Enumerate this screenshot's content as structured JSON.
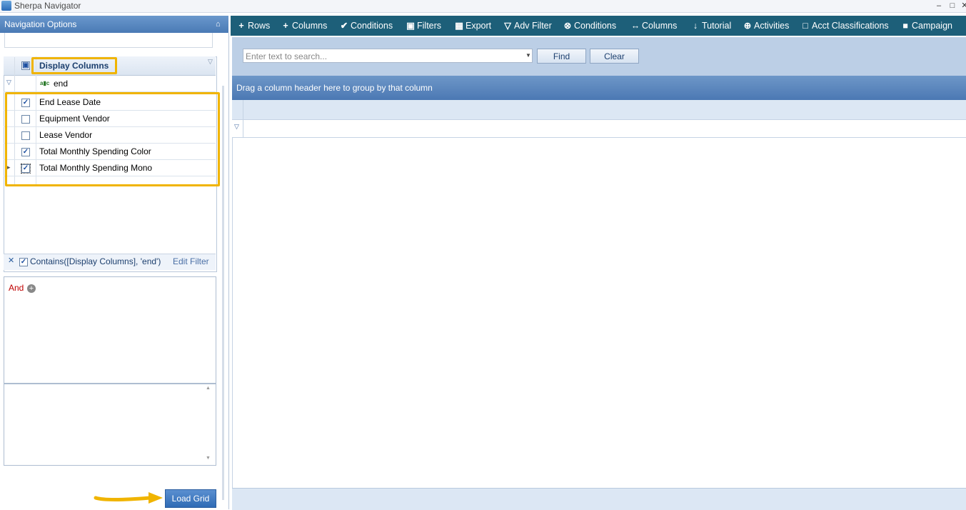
{
  "window": {
    "title": "Sherpa Navigator",
    "minimize": "‒",
    "maximize": "□",
    "close": "✕"
  },
  "nav": {
    "title": "Navigation Options",
    "pin": "⌂",
    "grid": {
      "header": "Display Columns",
      "filter_value": "end",
      "rows": [
        {
          "label": "End Lease Date",
          "checked": true
        },
        {
          "label": "Equipment Vendor",
          "checked": false
        },
        {
          "label": "Lease Vendor",
          "checked": false
        },
        {
          "label": "Total Monthly Spending Color",
          "checked": true
        },
        {
          "label": "Total Monthly Spending Mono",
          "checked": true
        }
      ],
      "filter_expression": "Contains([Display Columns], 'end')",
      "edit_filter": "Edit Filter"
    },
    "builder": {
      "operator": "And"
    },
    "load_button": "Load Grid"
  },
  "toolbar": {
    "items": [
      {
        "icon": "+",
        "label": "Rows"
      },
      {
        "icon": "+",
        "label": "Columns"
      },
      {
        "icon": "✔",
        "label": "Conditions"
      },
      {
        "icon": "▣",
        "label": "Filters"
      },
      {
        "icon": "▦",
        "label": "Export"
      },
      {
        "icon": "▽",
        "label": "Adv Filter"
      },
      {
        "icon": "⊗",
        "label": "Conditions"
      },
      {
        "icon": "↔",
        "label": "Columns"
      },
      {
        "icon": "↓",
        "label": "Tutorial"
      },
      {
        "icon": "⊕",
        "label": "Activities"
      },
      {
        "icon": "□",
        "label": "Acct Classifications"
      },
      {
        "icon": "■",
        "label": "Campaign"
      }
    ]
  },
  "search": {
    "placeholder": "Enter text to search...",
    "find": "Find",
    "clear": "Clear"
  },
  "grid": {
    "group_hint": "Drag a column header here to group by that column"
  },
  "colors": {
    "toolbar": "#1d5f79",
    "highlight": "#f0b400",
    "group_bar": "#5a87c0"
  }
}
